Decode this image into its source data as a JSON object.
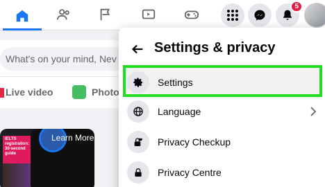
{
  "nav": {
    "tabs": [
      {
        "icon": "home-icon",
        "active": true
      },
      {
        "icon": "friends-icon",
        "active": false
      },
      {
        "icon": "flag-icon",
        "active": false
      },
      {
        "icon": "watch-icon",
        "active": false
      },
      {
        "icon": "gaming-icon",
        "active": false
      }
    ],
    "menu_icon": "grid-menu-icon",
    "messenger_icon": "messenger-icon",
    "notifications_icon": "bell-icon",
    "notifications_count": "5",
    "accent": "#1877f2",
    "badge_color": "#e41e3f"
  },
  "feed": {
    "composer_placeholder": "What's on your mind, Nev",
    "live_label": "Live video",
    "photo_label": "Photo/",
    "story_text": "IELTS registration: a 30-second guide",
    "learn_more": "Learn More"
  },
  "settings_panel": {
    "title": "Settings & privacy",
    "items": [
      {
        "label": "Settings",
        "icon": "gear-icon",
        "highlighted": true
      },
      {
        "label": "Language",
        "icon": "globe-icon",
        "has_chevron": true
      },
      {
        "label": "Privacy Checkup",
        "icon": "lock-heart-icon"
      },
      {
        "label": "Privacy Centre",
        "icon": "lock-icon"
      }
    ],
    "highlight_color": "#22dd22"
  }
}
